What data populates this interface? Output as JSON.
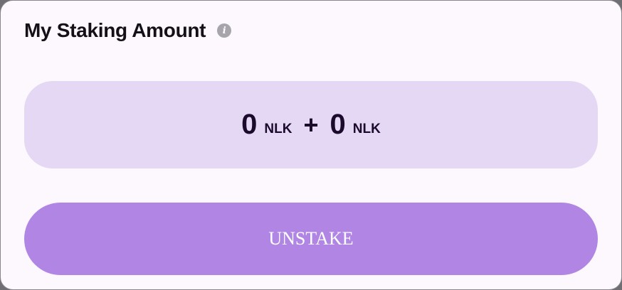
{
  "card": {
    "title": "My Staking Amount",
    "info_icon": "info-icon"
  },
  "amount": {
    "value_1": "0",
    "unit_1": "NLK",
    "operator": "+",
    "value_2": "0",
    "unit_2": "NLK"
  },
  "actions": {
    "unstake_label": "UNSTAKE"
  },
  "colors": {
    "card_bg": "#fdf8fd",
    "amount_bg": "#e5d8f5",
    "button_bg": "#b085e4",
    "text_dark": "#1c0a2c",
    "icon_gray": "#a7a4ab"
  }
}
